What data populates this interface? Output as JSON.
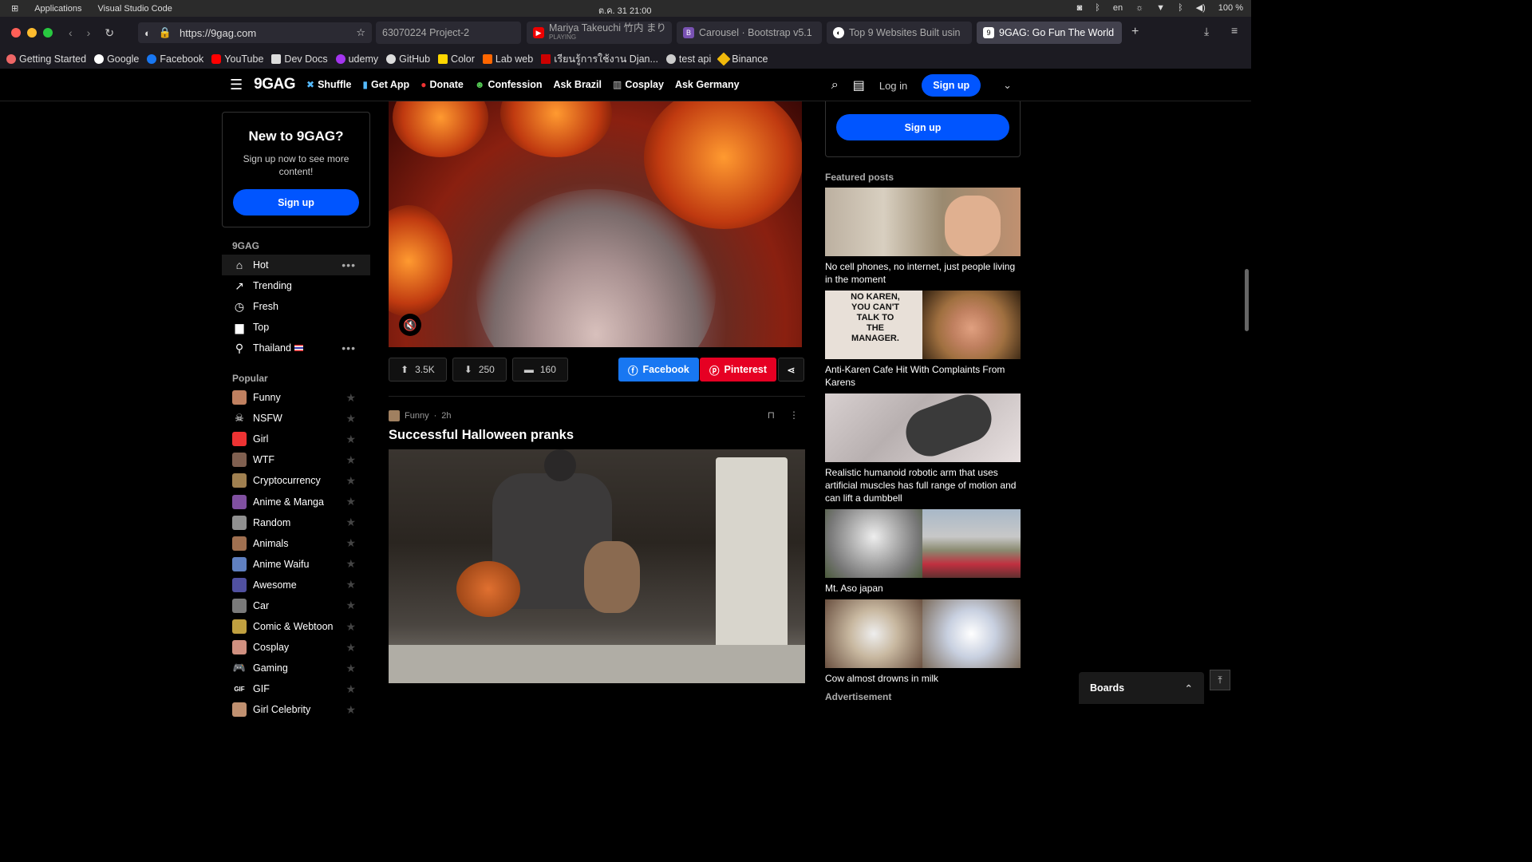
{
  "system": {
    "apps_label": "Applications",
    "active_app": "Visual Studio Code",
    "clock": "ต.ค. 31  21:00",
    "lang": "en",
    "battery": "100 %"
  },
  "browser": {
    "url": "https://9gag.com",
    "tabs": [
      {
        "label": "63070224 Project-2",
        "icon_color": "#2b2a33"
      },
      {
        "label": "Mariya Takeuchi 竹内 まり",
        "sub": "PLAYING",
        "icon_color": "#e00"
      },
      {
        "label": "Carousel · Bootstrap v5.1",
        "icon_color": "#7952b3"
      },
      {
        "label": "Top 9 Websites Built usin",
        "icon_color": "#fff"
      },
      {
        "label": "9GAG: Go Fun The World",
        "icon_color": "#fff"
      }
    ],
    "bookmarks": [
      "Getting Started",
      "Google",
      "Facebook",
      "YouTube",
      "Dev Docs",
      "udemy",
      "GitHub",
      "Color",
      "Lab web",
      "เรียนรู้การใช้งาน Djan...",
      "test api",
      "Binance"
    ]
  },
  "site": {
    "logo": "9GAG",
    "nav": [
      "Shuffle",
      "Get App",
      "Donate",
      "Confession",
      "Ask Brazil",
      "Cosplay",
      "Ask Germany"
    ],
    "login": "Log in",
    "signup": "Sign up"
  },
  "left": {
    "new_title": "New to 9GAG?",
    "new_text": "Sign up now to see more content!",
    "signup": "Sign up",
    "section": "9GAG",
    "items": [
      "Hot",
      "Trending",
      "Fresh",
      "Top",
      "Thailand"
    ],
    "popular_title": "Popular",
    "popular": [
      "Funny",
      "NSFW",
      "Girl",
      "WTF",
      "Cryptocurrency",
      "Anime & Manga",
      "Random",
      "Animals",
      "Anime Waifu",
      "Awesome",
      "Car",
      "Comic & Webtoon",
      "Cosplay",
      "Gaming",
      "GIF",
      "Girl Celebrity"
    ]
  },
  "post1": {
    "upvotes": "3.5K",
    "downvotes": "250",
    "comments": "160",
    "facebook": "Facebook",
    "pinterest": "Pinterest"
  },
  "post2": {
    "section": "Funny",
    "age": "2h",
    "title": "Successful Halloween pranks"
  },
  "right": {
    "signup": "Sign up",
    "featured_title": "Featured posts",
    "featured": [
      "No cell phones, no internet, just people living in the moment",
      "Anti-Karen Cafe Hit With Complaints From Karens",
      "Realistic humanoid robotic arm that uses artificial muscles has full range of motion and can lift a dumbbell",
      "Mt. Aso japan",
      "Cow almost drowns in milk"
    ],
    "sign_text": "NO KAREN, YOU CAN'T TALK TO THE MANAGER.",
    "advertisement": "Advertisement"
  },
  "boards": "Boards"
}
